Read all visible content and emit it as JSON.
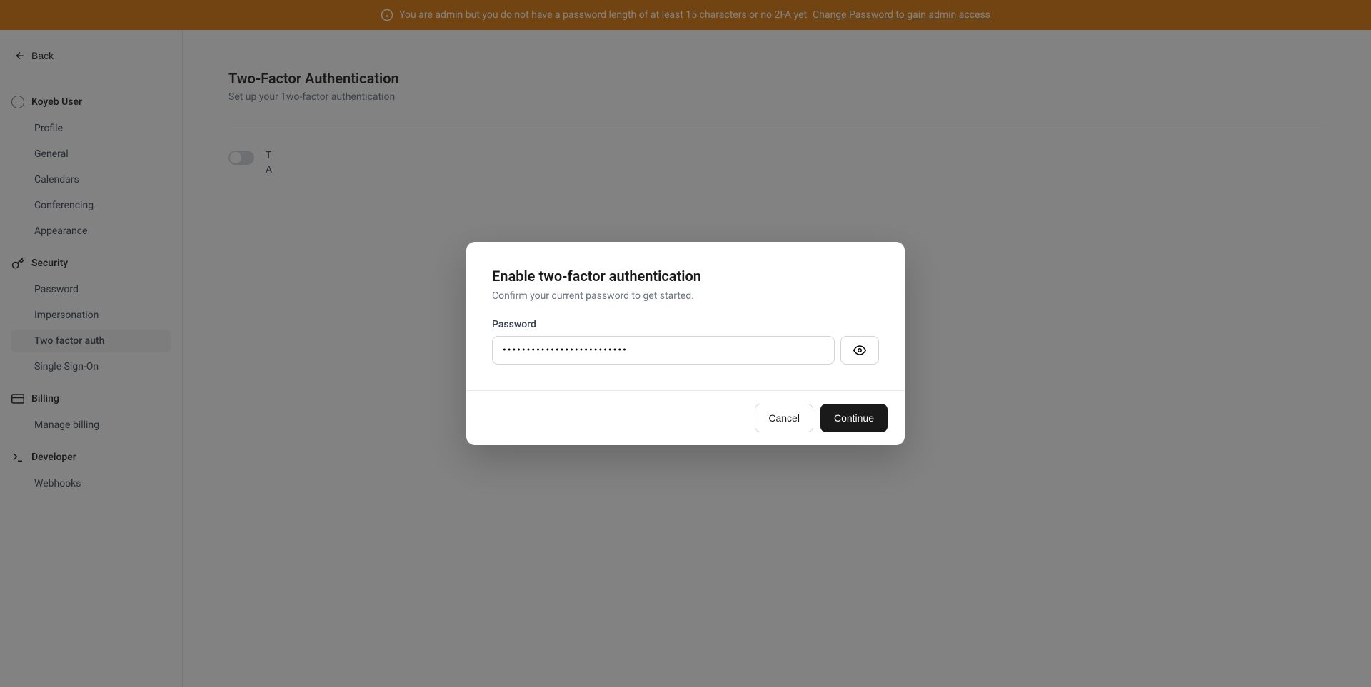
{
  "banner": {
    "message": "You are admin but you do not have a password length of at least 15 characters or no 2FA yet",
    "link": "Change Password to gain admin access"
  },
  "sidebar": {
    "back": "Back",
    "sections": {
      "user": {
        "name": "Koyeb User",
        "items": [
          "Profile",
          "General",
          "Calendars",
          "Conferencing",
          "Appearance"
        ]
      },
      "security": {
        "name": "Security",
        "items": [
          "Password",
          "Impersonation",
          "Two factor auth",
          "Single Sign-On"
        ]
      },
      "billing": {
        "name": "Billing",
        "items": [
          "Manage billing"
        ]
      },
      "developer": {
        "name": "Developer",
        "items": [
          "Webhooks"
        ]
      }
    }
  },
  "page": {
    "title": "Two-Factor Authentication",
    "subtitle": "Set up your Two-factor authentication",
    "toggle_label_line1": "T",
    "toggle_label_line2": "A"
  },
  "modal": {
    "title": "Enable two-factor authentication",
    "subtitle": "Confirm your current password to get started.",
    "password_label": "Password",
    "password_value": "••••••••••••••••••••••••••",
    "cancel": "Cancel",
    "continue": "Continue"
  }
}
